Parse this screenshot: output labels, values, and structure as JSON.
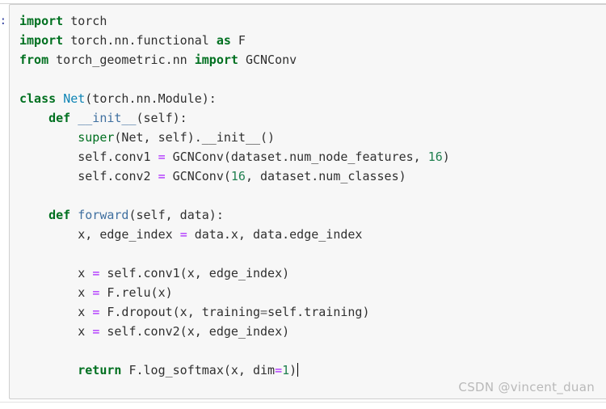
{
  "notebook": {
    "prompt_label": ":",
    "watermark": "CSDN @vincent_duan",
    "colors": {
      "cell_background": "#f7f7f7",
      "cell_border": "#cfcfcf",
      "page_background": "#ffffff",
      "keyword": "#007020",
      "class_name": "#0e84b5",
      "function_name": "#4070a0",
      "builtin": "#007020",
      "operator": "#aa22ff",
      "number": "#208050",
      "plain_text": "#303030",
      "prompt": "#303f9f",
      "watermark": "#b9b9b9"
    }
  },
  "code": {
    "language": "python",
    "lines": [
      {
        "id": 1,
        "indent": 0,
        "tokens": [
          {
            "t": "import",
            "c": "kw"
          },
          {
            "t": " torch",
            "c": "pl"
          }
        ]
      },
      {
        "id": 2,
        "indent": 0,
        "tokens": [
          {
            "t": "import",
            "c": "kw"
          },
          {
            "t": " torch.nn.functional ",
            "c": "pl"
          },
          {
            "t": "as",
            "c": "kw"
          },
          {
            "t": " F",
            "c": "pl"
          }
        ]
      },
      {
        "id": 3,
        "indent": 0,
        "tokens": [
          {
            "t": "from",
            "c": "kw"
          },
          {
            "t": " torch_geometric.nn ",
            "c": "pl"
          },
          {
            "t": "import",
            "c": "kw"
          },
          {
            "t": " GCNConv",
            "c": "pl"
          }
        ]
      },
      {
        "id": 4,
        "indent": 0,
        "tokens": []
      },
      {
        "id": 5,
        "indent": 0,
        "tokens": [
          {
            "t": "class",
            "c": "kw"
          },
          {
            "t": " ",
            "c": "pl"
          },
          {
            "t": "Net",
            "c": "nc"
          },
          {
            "t": "(torch.nn.Module):",
            "c": "pl"
          }
        ]
      },
      {
        "id": 6,
        "indent": 1,
        "tokens": [
          {
            "t": "def",
            "c": "kw"
          },
          {
            "t": " ",
            "c": "pl"
          },
          {
            "t": "__init__",
            "c": "nf"
          },
          {
            "t": "(self):",
            "c": "pl"
          }
        ]
      },
      {
        "id": 7,
        "indent": 2,
        "tokens": [
          {
            "t": "super",
            "c": "nb"
          },
          {
            "t": "(Net, self).__init__()",
            "c": "pl"
          }
        ]
      },
      {
        "id": 8,
        "indent": 2,
        "tokens": [
          {
            "t": "self.conv1 ",
            "c": "pl"
          },
          {
            "t": "=",
            "c": "op"
          },
          {
            "t": " GCNConv(dataset.num_node_features, ",
            "c": "pl"
          },
          {
            "t": "16",
            "c": "mi"
          },
          {
            "t": ")",
            "c": "pl"
          }
        ]
      },
      {
        "id": 9,
        "indent": 2,
        "tokens": [
          {
            "t": "self.conv2 ",
            "c": "pl"
          },
          {
            "t": "=",
            "c": "op"
          },
          {
            "t": " GCNConv(",
            "c": "pl"
          },
          {
            "t": "16",
            "c": "mi"
          },
          {
            "t": ", dataset.num_classes)",
            "c": "pl"
          }
        ]
      },
      {
        "id": 10,
        "indent": 0,
        "tokens": []
      },
      {
        "id": 11,
        "indent": 1,
        "tokens": [
          {
            "t": "def",
            "c": "kw"
          },
          {
            "t": " ",
            "c": "pl"
          },
          {
            "t": "forward",
            "c": "nf"
          },
          {
            "t": "(self, data):",
            "c": "pl"
          }
        ]
      },
      {
        "id": 12,
        "indent": 2,
        "tokens": [
          {
            "t": "x, edge_index ",
            "c": "pl"
          },
          {
            "t": "=",
            "c": "op"
          },
          {
            "t": " data.x, data.edge_index",
            "c": "pl"
          }
        ]
      },
      {
        "id": 13,
        "indent": 0,
        "tokens": []
      },
      {
        "id": 14,
        "indent": 2,
        "tokens": [
          {
            "t": "x ",
            "c": "pl"
          },
          {
            "t": "=",
            "c": "op"
          },
          {
            "t": " self.conv1(x, edge_index)",
            "c": "pl"
          }
        ]
      },
      {
        "id": 15,
        "indent": 2,
        "tokens": [
          {
            "t": "x ",
            "c": "pl"
          },
          {
            "t": "=",
            "c": "op"
          },
          {
            "t": " F.relu(x)",
            "c": "pl"
          }
        ]
      },
      {
        "id": 16,
        "indent": 2,
        "tokens": [
          {
            "t": "x ",
            "c": "pl"
          },
          {
            "t": "=",
            "c": "op"
          },
          {
            "t": " F.dropout(x, training",
            "c": "pl"
          },
          {
            "t": "=",
            "c": "opk"
          },
          {
            "t": "self.training)",
            "c": "pl"
          }
        ]
      },
      {
        "id": 17,
        "indent": 2,
        "tokens": [
          {
            "t": "x ",
            "c": "pl"
          },
          {
            "t": "=",
            "c": "op"
          },
          {
            "t": " self.conv2(x, edge_index)",
            "c": "pl"
          }
        ]
      },
      {
        "id": 18,
        "indent": 0,
        "tokens": []
      },
      {
        "id": 19,
        "indent": 2,
        "tokens": [
          {
            "t": "return",
            "c": "kw"
          },
          {
            "t": " F.log_softmax(x, dim",
            "c": "pl"
          },
          {
            "t": "=",
            "c": "op"
          },
          {
            "t": "1",
            "c": "mi"
          },
          {
            "t": ")",
            "c": "pl"
          }
        ],
        "caret": true
      }
    ]
  }
}
